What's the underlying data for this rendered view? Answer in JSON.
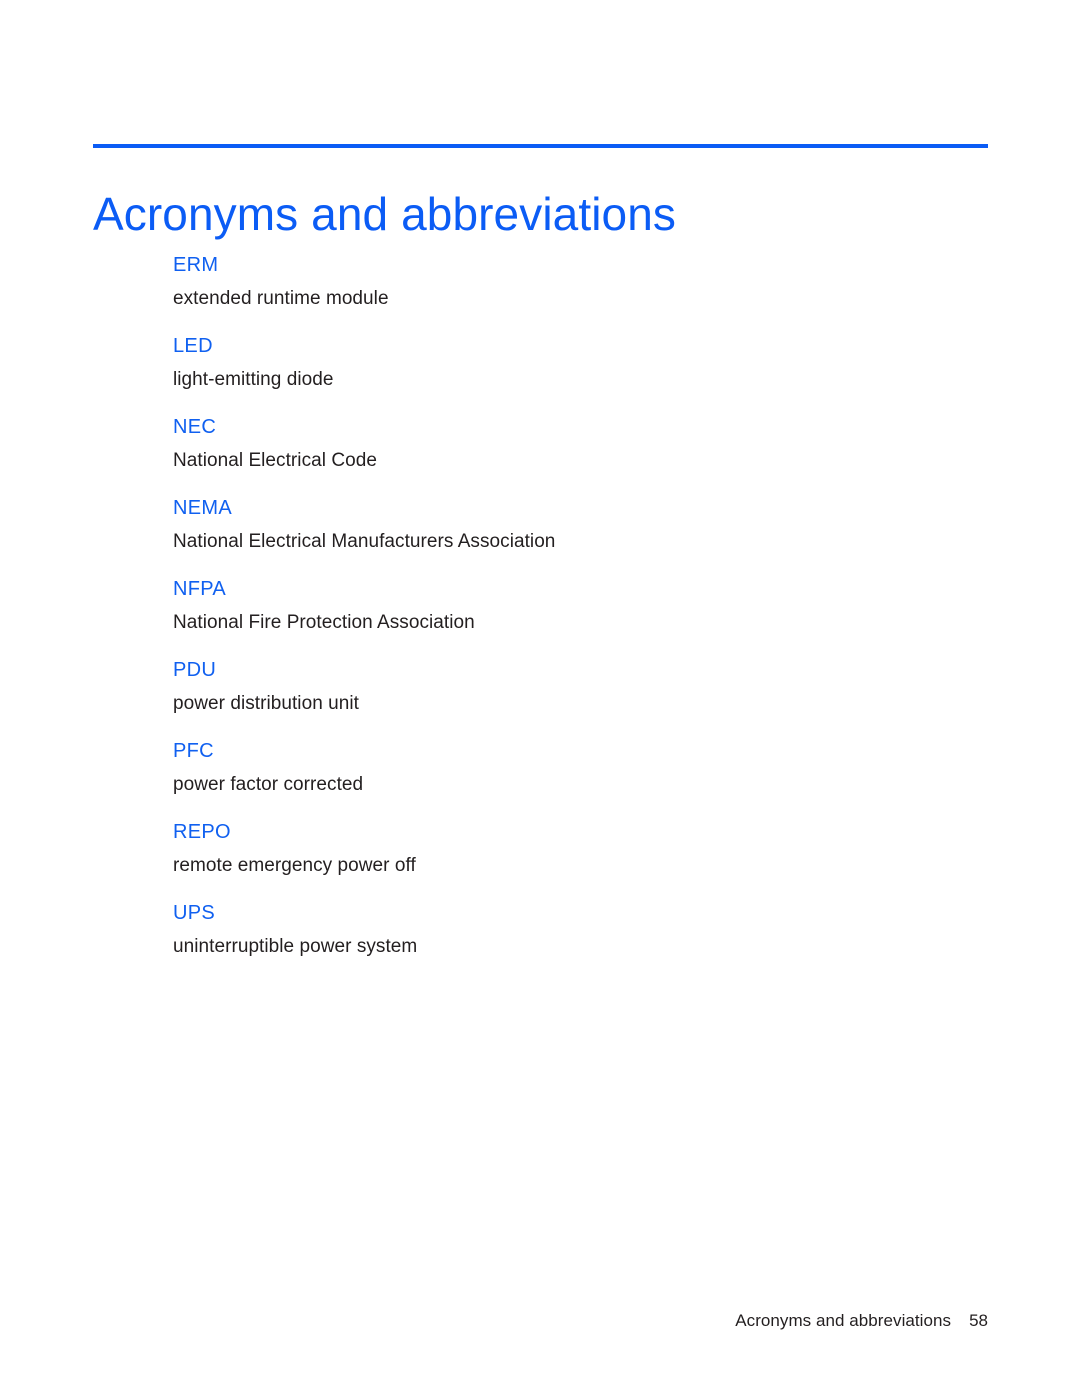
{
  "document": {
    "title": "Acronyms and abbreviations",
    "accent_color": "#0B5CF5",
    "term_color": "#1060F0",
    "body_color": "#231F20",
    "background_color": "#FFFFFF"
  },
  "glossary": {
    "entries": [
      {
        "term": "ERM",
        "definition": "extended runtime module"
      },
      {
        "term": "LED",
        "definition": "light-emitting diode"
      },
      {
        "term": "NEC",
        "definition": "National Electrical Code"
      },
      {
        "term": "NEMA",
        "definition": "National Electrical Manufacturers Association"
      },
      {
        "term": "NFPA",
        "definition": "National Fire Protection Association"
      },
      {
        "term": "PDU",
        "definition": "power distribution unit"
      },
      {
        "term": "PFC",
        "definition": "power factor corrected"
      },
      {
        "term": "REPO",
        "definition": "remote emergency power off"
      },
      {
        "term": "UPS",
        "definition": "uninterruptible power system"
      }
    ]
  },
  "footer": {
    "label": "Acronyms and abbreviations",
    "page_number": "58"
  }
}
